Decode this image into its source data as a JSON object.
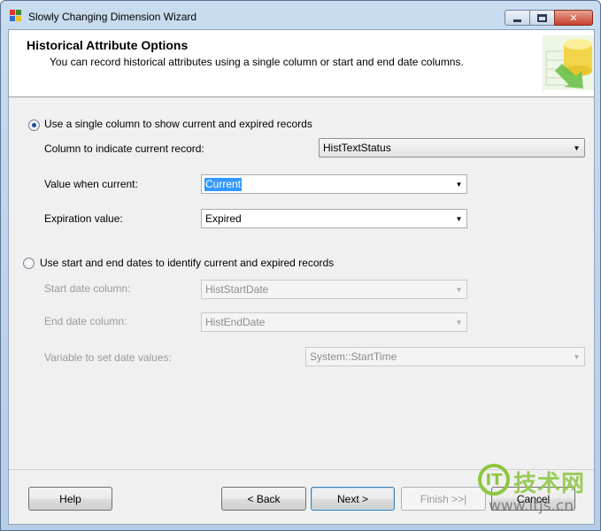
{
  "window": {
    "title": "Slowly Changing Dimension Wizard"
  },
  "header": {
    "title": "Historical Attribute Options",
    "subtitle": "You can record historical attributes using a single column or start and end date columns."
  },
  "single_column": {
    "radio_label": "Use a single column to show current and expired records",
    "selected": true,
    "column_label": "Column to indicate current record:",
    "column_value": "HistTextStatus",
    "value_current_label": "Value when current:",
    "value_current_value": "Current",
    "expiration_label": "Expiration value:",
    "expiration_value": "Expired"
  },
  "date_columns": {
    "radio_label": "Use start and end dates to identify current and expired records",
    "selected": false,
    "start_label": "Start date column:",
    "start_value": "HistStartDate",
    "end_label": "End date column:",
    "end_value": "HistEndDate",
    "variable_label": "Variable to set date values:",
    "variable_value": "System::StartTime"
  },
  "buttons": {
    "help": "Help",
    "back": "< Back",
    "next": "Next >",
    "finish": "Finish >>|",
    "cancel": "Cancel"
  },
  "watermark": {
    "chinese": "技术网",
    "url": "www.itjs.cn",
    "color": "#8cc63f"
  }
}
